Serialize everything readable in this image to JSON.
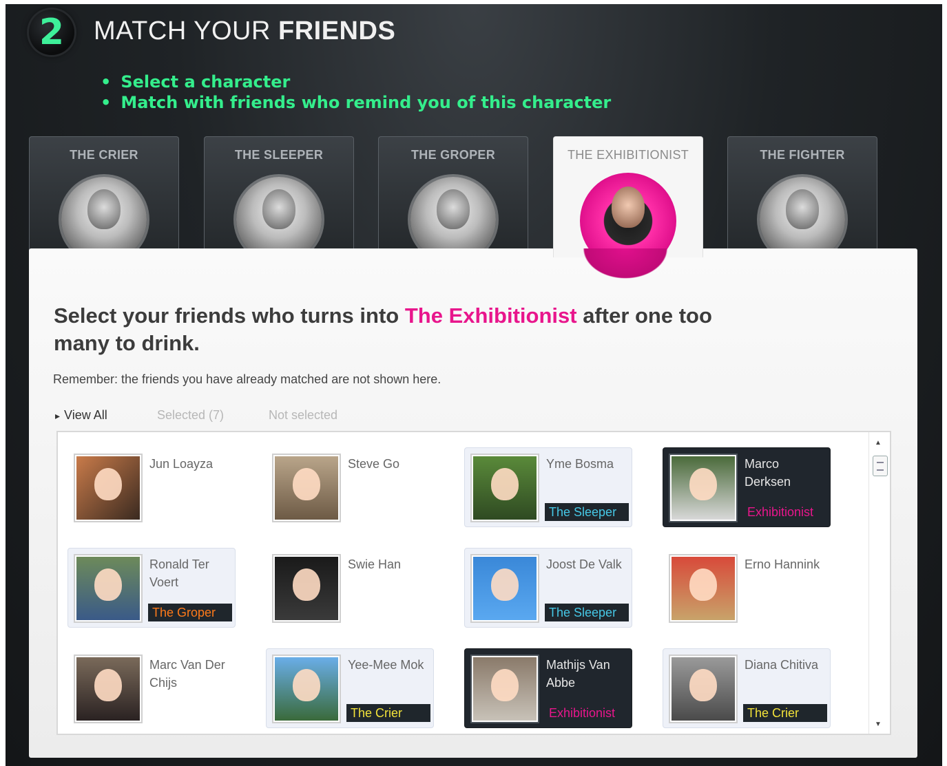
{
  "header": {
    "step": "2",
    "title_regular": "MATCH YOUR ",
    "title_bold": "FRIENDS",
    "instructions": [
      "Select a character",
      "Match with friends who remind you of this character"
    ]
  },
  "characters": [
    {
      "label": "THE CRIER",
      "active": false
    },
    {
      "label": "THE SLEEPER",
      "active": false
    },
    {
      "label": "THE GROPER",
      "active": false
    },
    {
      "label": "THE EXHIBITIONIST",
      "active": true
    },
    {
      "label": "THE FIGHTER",
      "active": false
    }
  ],
  "panel": {
    "headline_pre": "Select your friends who turns into ",
    "headline_highlight": "The Exhibitionist",
    "headline_post": " after one too many to drink.",
    "note": "Remember: the friends you have already matched are not shown here.",
    "filters": {
      "view_all": "View All",
      "selected": "Selected (7)",
      "not_selected": "Not selected"
    }
  },
  "colors": {
    "accent_green": "#34ee8c",
    "accent_pink": "#e8168c",
    "sleeper_cyan": "#46c8e6",
    "groper_orange": "#ff7a1a",
    "crier_yellow": "#f2e23a"
  },
  "friends": [
    {
      "name": "Jun Loayza",
      "tag": "",
      "style": "plain",
      "tag_color": ""
    },
    {
      "name": "Steve Go",
      "tag": "",
      "style": "plain",
      "tag_color": ""
    },
    {
      "name": "Yme Bosma",
      "tag": "The Sleeper",
      "style": "matched",
      "tag_color": "#46c8e6"
    },
    {
      "name": "Marco Derksen",
      "tag": "Exhibitionist",
      "style": "dark",
      "tag_color": "#e8168c"
    },
    {
      "name": "Ronald Ter Voert",
      "tag": "The Groper",
      "style": "matched",
      "tag_color": "#ff7a1a"
    },
    {
      "name": "Swie Han",
      "tag": "",
      "style": "plain",
      "tag_color": ""
    },
    {
      "name": "Joost De Valk",
      "tag": "The Sleeper",
      "style": "matched",
      "tag_color": "#46c8e6"
    },
    {
      "name": "Erno Hannink",
      "tag": "",
      "style": "plain",
      "tag_color": ""
    },
    {
      "name": "Marc Van Der Chijs",
      "tag": "",
      "style": "plain",
      "tag_color": ""
    },
    {
      "name": "Yee-Mee Mok",
      "tag": "The Crier",
      "style": "matched",
      "tag_color": "#f2e23a"
    },
    {
      "name": "Mathijs Van Abbe",
      "tag": "Exhibitionist",
      "style": "dark",
      "tag_color": "#e8168c"
    },
    {
      "name": "Diana Chitiva",
      "tag": "The Crier",
      "style": "matched",
      "tag_color": "#f2e23a"
    }
  ]
}
